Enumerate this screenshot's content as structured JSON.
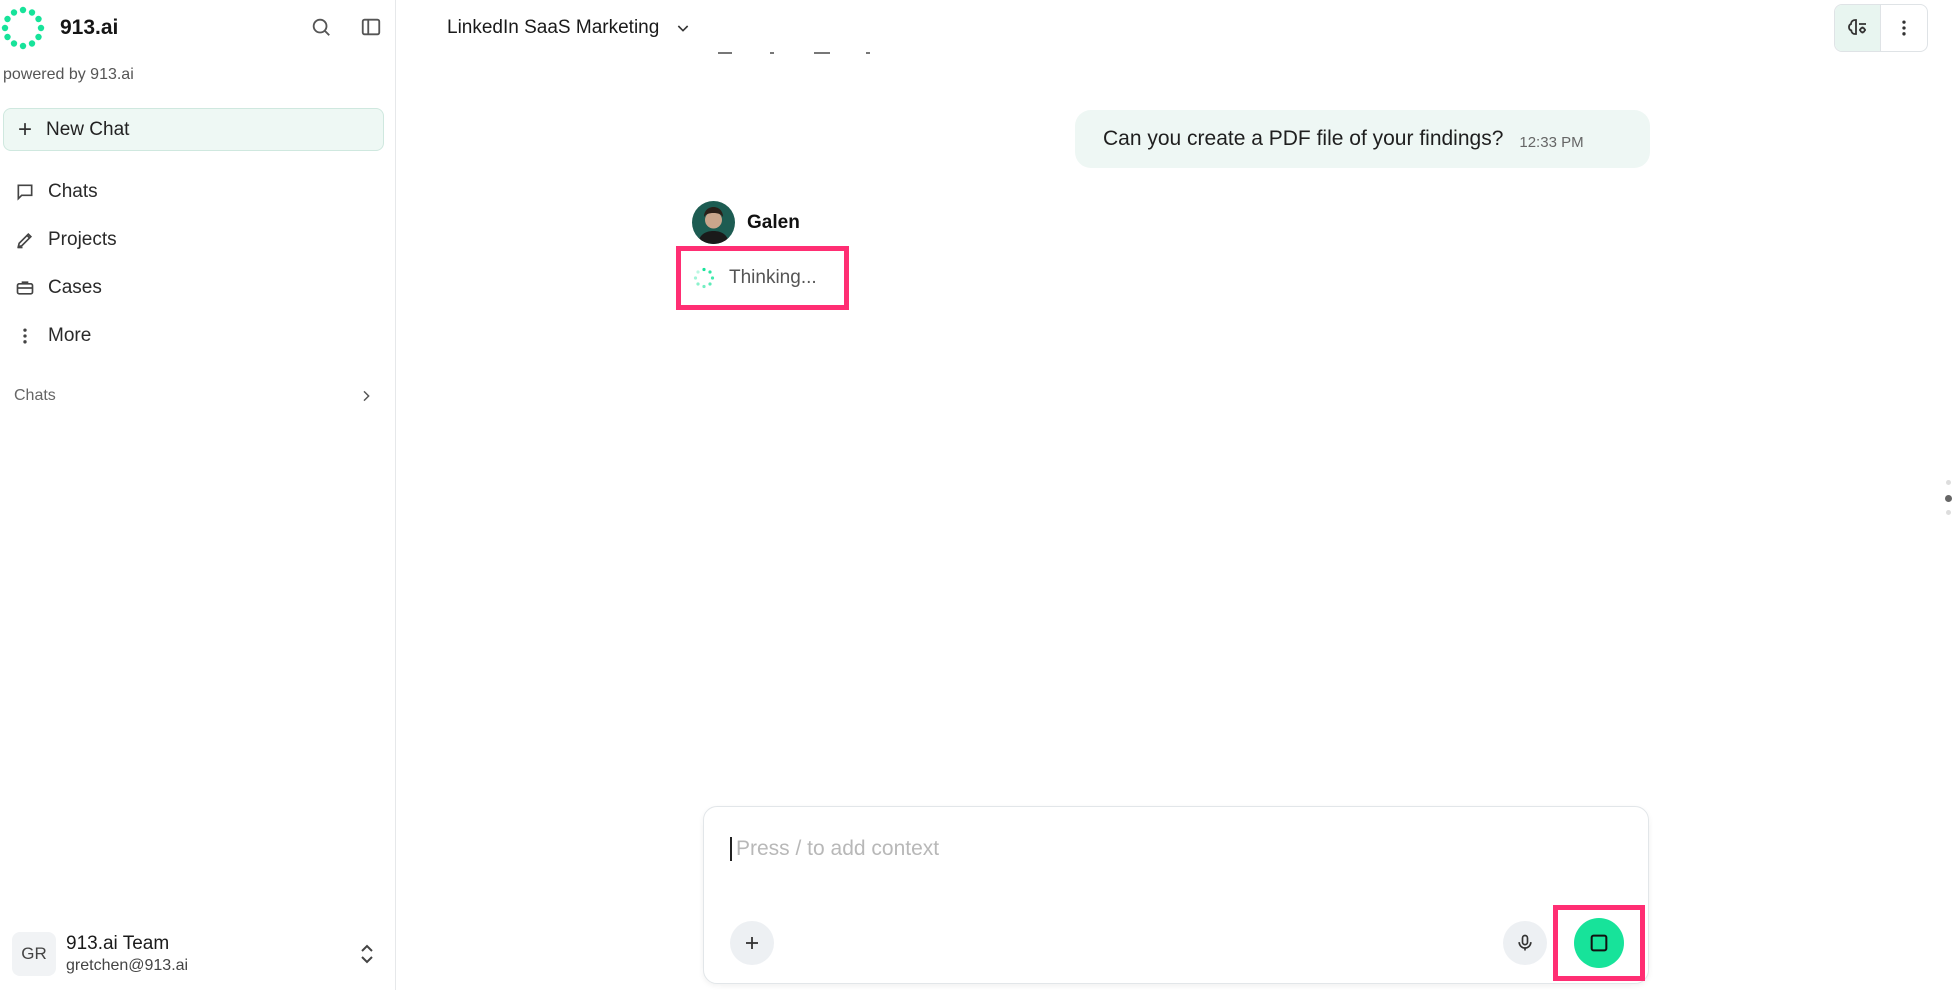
{
  "app": {
    "brand_name": "913.ai",
    "powered_by": "powered by 913.ai",
    "accent_color": "#17e39a",
    "highlight_color": "#ff2e73"
  },
  "sidebar": {
    "new_chat_label": "New Chat",
    "nav_items": [
      {
        "label": "Chats",
        "icon": "chat-bubble-icon"
      },
      {
        "label": "Projects",
        "icon": "pen-icon"
      },
      {
        "label": "Cases",
        "icon": "briefcase-icon"
      },
      {
        "label": "More",
        "icon": "more-vertical-icon"
      }
    ],
    "section_label": "Chats",
    "user": {
      "initials": "GR",
      "name": "913.ai Team",
      "email": "gretchen@913.ai"
    }
  },
  "header": {
    "title": "LinkedIn SaaS Marketing"
  },
  "conversation": {
    "user_message": {
      "text": "Can you create a PDF file of your findings?",
      "time": "12:33 PM"
    },
    "assistant": {
      "name": "Galen",
      "status": "Thinking..."
    }
  },
  "composer": {
    "placeholder": "Press / to add context",
    "value": ""
  }
}
